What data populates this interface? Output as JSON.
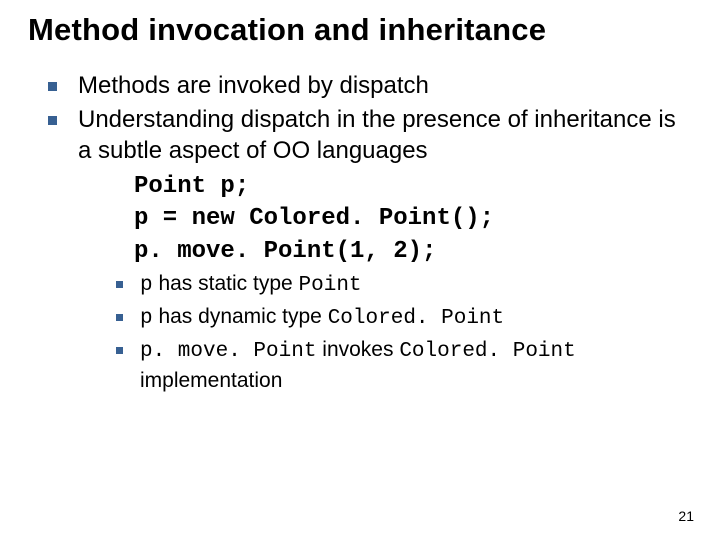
{
  "title": "Method invocation and inheritance",
  "bullets": {
    "b1": "Methods are invoked by dispatch",
    "b2": "Understanding dispatch in the presence of inheritance is a subtle aspect of OO languages"
  },
  "code": {
    "l1": "Point p;",
    "l2": "p = new Colored. Point();",
    "l3": "p. move. Point(1, 2);"
  },
  "sub": {
    "s1a": "p",
    "s1b": " has static type ",
    "s1c": "Point",
    "s2a": "p",
    "s2b": " has dynamic type ",
    "s2c": "Colored. Point",
    "s3a": "p. move. Point",
    "s3b": " invokes ",
    "s3c": "Colored. Point",
    "s3d": " implementation"
  },
  "pagenum": "21"
}
